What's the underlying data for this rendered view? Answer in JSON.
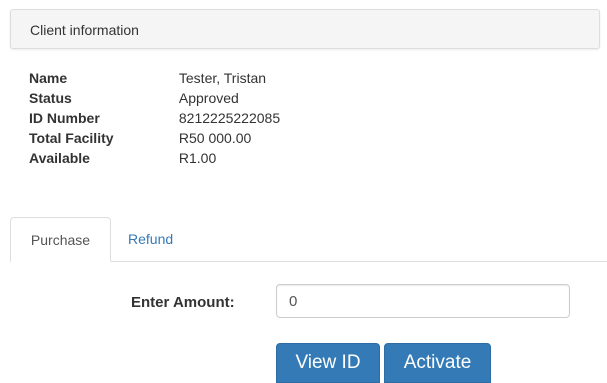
{
  "panel": {
    "title": "Client information"
  },
  "client": {
    "rows": [
      {
        "label": "Name",
        "value": "Tester, Tristan"
      },
      {
        "label": "Status",
        "value": "Approved"
      },
      {
        "label": "ID Number",
        "value": "8212225222085"
      },
      {
        "label": "Total Facility",
        "value": "R50 000.00"
      },
      {
        "label": "Available",
        "value": "R1.00"
      }
    ]
  },
  "tabs": [
    {
      "label": "Purchase",
      "active": true
    },
    {
      "label": "Refund",
      "active": false
    }
  ],
  "form": {
    "amount_label": "Enter Amount:",
    "amount_value": "0"
  },
  "actions": {
    "view_id_label": "View ID",
    "activate_label": "Activate"
  },
  "colors": {
    "primary": "#337ab7",
    "link": "#337ab7",
    "panel_bg": "#f5f5f5",
    "border": "#dddddd"
  }
}
